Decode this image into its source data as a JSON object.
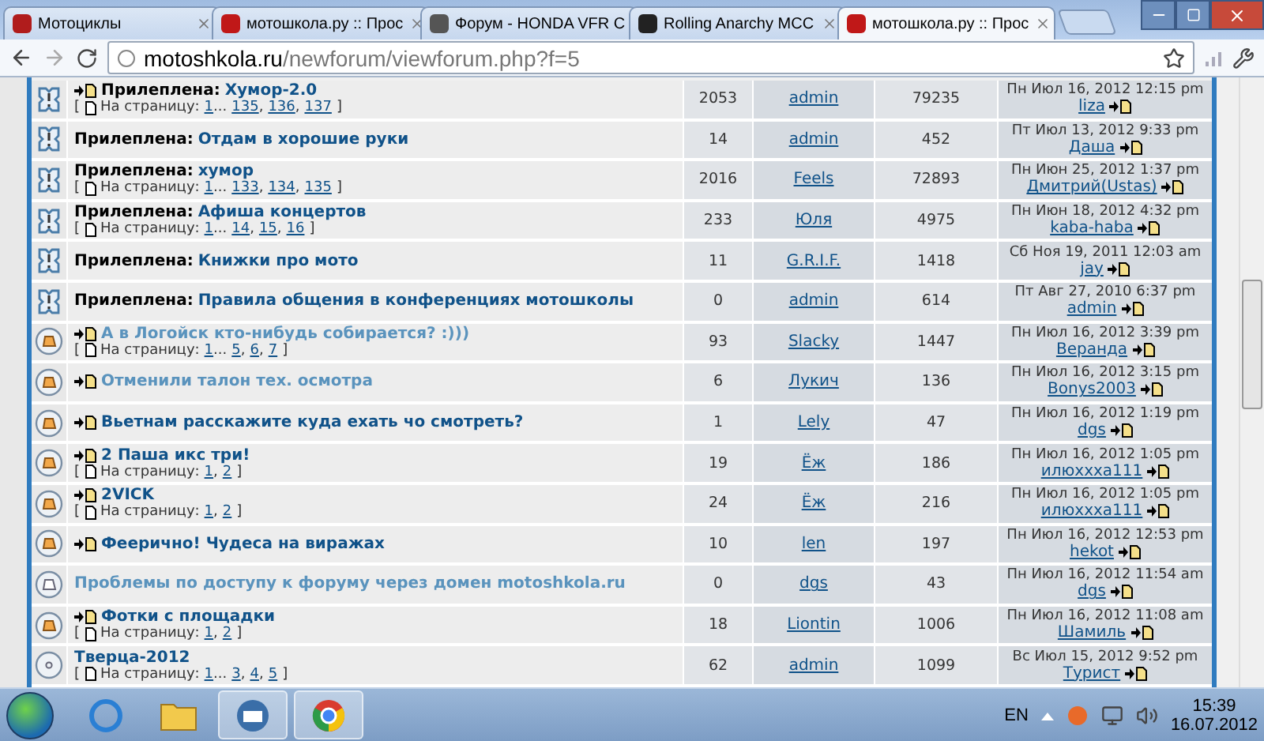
{
  "tabs": [
    {
      "title": "Мотоциклы",
      "selected": false
    },
    {
      "title": "мотошкола.ру :: Прос",
      "selected": false
    },
    {
      "title": "Форум - HONDA VFR C",
      "selected": false
    },
    {
      "title": "Rolling Anarchy MCC",
      "selected": false
    },
    {
      "title": "мотошкола.ру :: Прос",
      "selected": true
    }
  ],
  "address": {
    "host": "motoshkola.ru",
    "path": "/newforum/viewforum.php?f=5"
  },
  "topics": [
    {
      "kind": "sticky",
      "new": true,
      "prefix": "Прилеплена:",
      "title": "Хумор-2.0",
      "visited": false,
      "pages": {
        "open": "[",
        "label": "На страницу:",
        "items": [
          {
            "label": "1",
            "sep": "..."
          },
          {
            "label": "135",
            "sep": ","
          },
          {
            "label": "136",
            "sep": ","
          },
          {
            "label": "137"
          }
        ],
        "close": "]"
      },
      "replies": "2053",
      "author": "admin",
      "views": "79235",
      "last_date": "Пн Июл 16, 2012 12:15 pm",
      "last_author": "liza"
    },
    {
      "kind": "sticky",
      "new": false,
      "prefix": "Прилеплена:",
      "title": "Отдам в хорошие руки",
      "visited": false,
      "replies": "14",
      "author": "admin",
      "views": "452",
      "last_date": "Пт Июл 13, 2012 9:33 pm",
      "last_author": "Даша"
    },
    {
      "kind": "sticky",
      "new": false,
      "prefix": "Прилеплена:",
      "title": "хумор",
      "visited": false,
      "pages": {
        "open": "[",
        "label": "На страницу:",
        "items": [
          {
            "label": "1",
            "sep": "..."
          },
          {
            "label": "133",
            "sep": ","
          },
          {
            "label": "134",
            "sep": ","
          },
          {
            "label": "135"
          }
        ],
        "close": "]"
      },
      "replies": "2016",
      "author": "Feels",
      "views": "72893",
      "last_date": "Пн Июн 25, 2012 1:37 pm",
      "last_author": "Дмитрий(Ustas)"
    },
    {
      "kind": "sticky",
      "new": false,
      "prefix": "Прилеплена:",
      "title": "Афиша концертов",
      "visited": false,
      "pages": {
        "open": "[",
        "label": "На страницу:",
        "items": [
          {
            "label": "1",
            "sep": "..."
          },
          {
            "label": "14",
            "sep": ","
          },
          {
            "label": "15",
            "sep": ","
          },
          {
            "label": "16"
          }
        ],
        "close": "]"
      },
      "replies": "233",
      "author": "Юля",
      "views": "4975",
      "last_date": "Пн Июн 18, 2012 4:32 pm",
      "last_author": "kaba-haba"
    },
    {
      "kind": "sticky",
      "new": false,
      "prefix": "Прилеплена:",
      "title": "Книжки про мото",
      "visited": false,
      "replies": "11",
      "author": "G.R.I.F.",
      "views": "1418",
      "last_date": "Сб Ноя 19, 2011 12:03 am",
      "last_author": "jay"
    },
    {
      "kind": "sticky",
      "new": false,
      "prefix": "Прилеплена:",
      "title": "Правила общения в конференциях мотошколы",
      "visited": false,
      "replies": "0",
      "author": "admin",
      "views": "614",
      "last_date": "Пт Авг 27, 2010 6:37 pm",
      "last_author": "admin"
    },
    {
      "kind": "topic",
      "new": true,
      "title": "А в Логойск кто-нибудь собирается? :)))",
      "visited": true,
      "pages": {
        "open": "[",
        "label": "На страницу:",
        "items": [
          {
            "label": "1",
            "sep": "..."
          },
          {
            "label": "5",
            "sep": ","
          },
          {
            "label": "6",
            "sep": ","
          },
          {
            "label": "7"
          }
        ],
        "close": "]"
      },
      "replies": "93",
      "author": "Slacky",
      "views": "1447",
      "last_date": "Пн Июл 16, 2012 3:39 pm",
      "last_author": "Веранда"
    },
    {
      "kind": "topic",
      "new": true,
      "title": "Отменили талон тех. осмотра",
      "visited": true,
      "replies": "6",
      "author": "Лукич",
      "views": "136",
      "last_date": "Пн Июл 16, 2012 3:15 pm",
      "last_author": "Bonys2003"
    },
    {
      "kind": "topic",
      "new": true,
      "title": "Вьетнам расскажите куда ехать чо смотреть?",
      "visited": false,
      "replies": "1",
      "author": "Lely",
      "views": "47",
      "last_date": "Пн Июл 16, 2012 1:19 pm",
      "last_author": "dgs"
    },
    {
      "kind": "topic",
      "new": true,
      "title": "2 Паша икс три!",
      "visited": false,
      "pages": {
        "open": "[",
        "label": "На страницу:",
        "items": [
          {
            "label": "1",
            "sep": ","
          },
          {
            "label": "2"
          }
        ],
        "close": "]"
      },
      "replies": "19",
      "author": "Ёж",
      "views": "186",
      "last_date": "Пн Июл 16, 2012 1:05 pm",
      "last_author": "илюххха111"
    },
    {
      "kind": "topic",
      "new": true,
      "title": "2VICK",
      "visited": false,
      "pages": {
        "open": "[",
        "label": "На страницу:",
        "items": [
          {
            "label": "1",
            "sep": ","
          },
          {
            "label": "2"
          }
        ],
        "close": "]"
      },
      "replies": "24",
      "author": "Ёж",
      "views": "216",
      "last_date": "Пн Июл 16, 2012 1:05 pm",
      "last_author": "илюххха111"
    },
    {
      "kind": "topic",
      "new": true,
      "title": "Феерично! Чудеса на виражах",
      "visited": false,
      "replies": "10",
      "author": "len",
      "views": "197",
      "last_date": "Пн Июл 16, 2012 12:53 pm",
      "last_author": "hekot"
    },
    {
      "kind": "read",
      "new": false,
      "title": "Проблемы по доступу к форуму через домен motoshkola.ru",
      "visited": true,
      "replies": "0",
      "author": "dgs",
      "views": "43",
      "last_date": "Пн Июл 16, 2012 11:54 am",
      "last_author": "dgs"
    },
    {
      "kind": "topic",
      "new": true,
      "title": "Фотки с площадки",
      "visited": false,
      "pages": {
        "open": "[",
        "label": "На страницу:",
        "items": [
          {
            "label": "1",
            "sep": ","
          },
          {
            "label": "2"
          }
        ],
        "close": "]"
      },
      "replies": "18",
      "author": "Liontin",
      "views": "1006",
      "last_date": "Пн Июл 16, 2012 11:08 am",
      "last_author": "Шамиль"
    },
    {
      "kind": "small",
      "new": false,
      "title": "Тверца-2012",
      "visited": false,
      "pages": {
        "open": "[",
        "label": "На страницу:",
        "items": [
          {
            "label": "1",
            "sep": "..."
          },
          {
            "label": "3",
            "sep": ","
          },
          {
            "label": "4",
            "sep": ","
          },
          {
            "label": "5"
          }
        ],
        "close": "]"
      },
      "replies": "62",
      "author": "admin",
      "views": "1099",
      "last_date": "Вс Июл 15, 2012 9:52 pm",
      "last_author": "Турист"
    }
  ],
  "taskbar": {
    "language": "EN",
    "time": "15:39",
    "date": "16.07.2012"
  }
}
